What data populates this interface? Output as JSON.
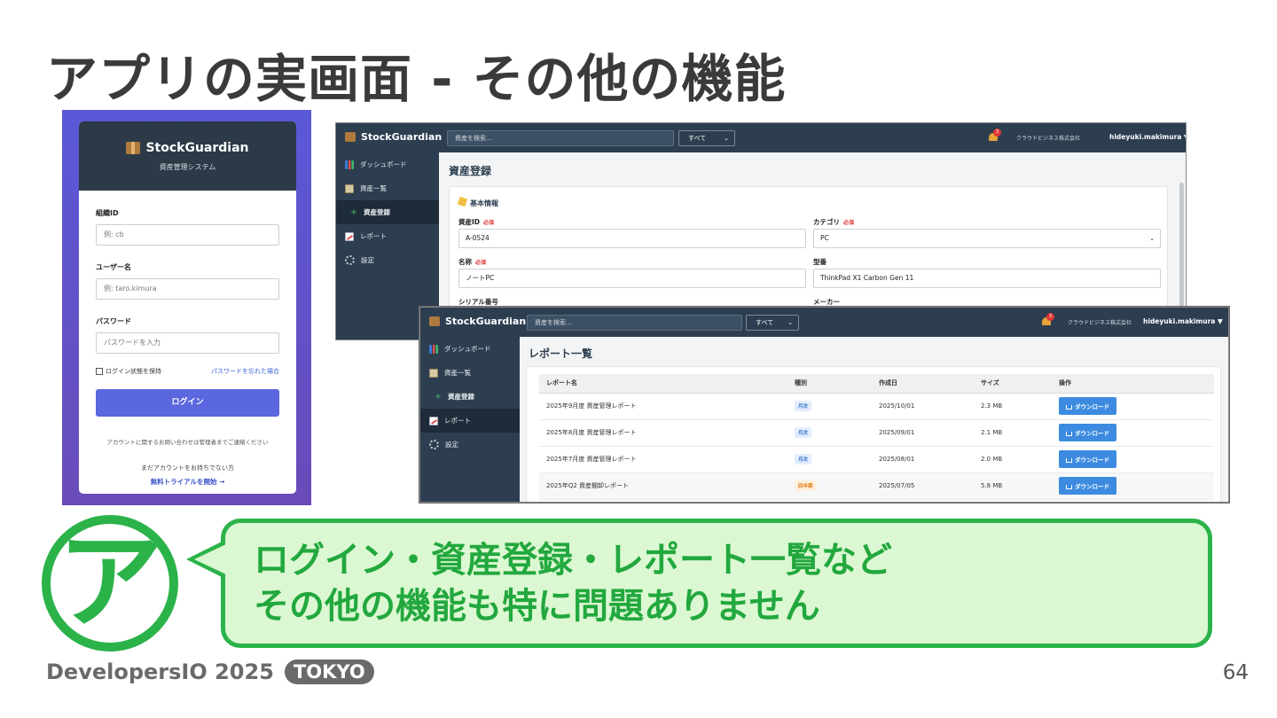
{
  "slide": {
    "title": "アプリの実画面 - その他の機能",
    "page_number": "64",
    "footer": {
      "brand": "DevelopersIO 2025",
      "badge": "TOKYO"
    }
  },
  "login": {
    "brand": "StockGuardian",
    "subtitle": "資産管理システム",
    "org_label": "組織ID",
    "org_placeholder": "例: cb",
    "user_label": "ユーザー名",
    "user_placeholder": "例: taro.kimura",
    "password_label": "パスワード",
    "password_placeholder": "パスワードを入力",
    "remember": "ログイン状態を保持",
    "forgot": "パスワードを忘れた場合",
    "login_button": "ログイン",
    "note": "アカウントに関するお問い合わせは管理者までご連絡ください",
    "no_account": "まだアカウントをお持ちでない方",
    "trial_link": "無料トライアルを開始 →"
  },
  "app": {
    "brand": "StockGuardian",
    "search_placeholder": "資産を検索...",
    "filter": "すべて",
    "notification_count": "3",
    "company": "クラウドビジネス株式会社",
    "user": "hideyuki.makimura",
    "user_caret": "▼",
    "sidebar": [
      {
        "label": "ダッシュボード",
        "icon": "chart-icon"
      },
      {
        "label": "資産一覧",
        "icon": "clipboard-icon"
      },
      {
        "label": "資産登録",
        "icon": "plus-icon"
      },
      {
        "label": "レポート",
        "icon": "trend-icon"
      },
      {
        "label": "設定",
        "icon": "gear-icon"
      }
    ]
  },
  "asset_form": {
    "page_title": "資産登録",
    "section": "基本情報",
    "required": "必須",
    "asset_id_label": "資産ID",
    "asset_id_value": "A-0524",
    "category_label": "カテゴリ",
    "category_value": "PC",
    "name_label": "名称",
    "name_value": "ノートPC",
    "model_label": "型番",
    "model_value": "ThinkPad X1 Carbon Gen 11",
    "serial_label": "シリアル番号",
    "maker_label": "メーカー"
  },
  "reports": {
    "page_title": "レポート一覧",
    "columns": [
      "レポート名",
      "種別",
      "作成日",
      "サイズ",
      "操作"
    ],
    "download": "ダウンロード",
    "rows": [
      {
        "name": "2025年9月度 資産管理レポート",
        "type": "月次",
        "date": "2025/10/01",
        "size": "2.3 MB"
      },
      {
        "name": "2025年8月度 資産管理レポート",
        "type": "月次",
        "date": "2025/09/01",
        "size": "2.1 MB"
      },
      {
        "name": "2025年7月度 資産管理レポート",
        "type": "月次",
        "date": "2025/08/01",
        "size": "2.0 MB"
      },
      {
        "name": "2025年Q2 資産棚卸レポート",
        "type": "四半期",
        "date": "2025/07/05",
        "size": "5.8 MB"
      }
    ]
  },
  "speech": {
    "avatar_letter": "ア",
    "line1": "ログイン・資産登録・レポート一覧など",
    "line2": "その他の機能も特に問題ありません"
  }
}
